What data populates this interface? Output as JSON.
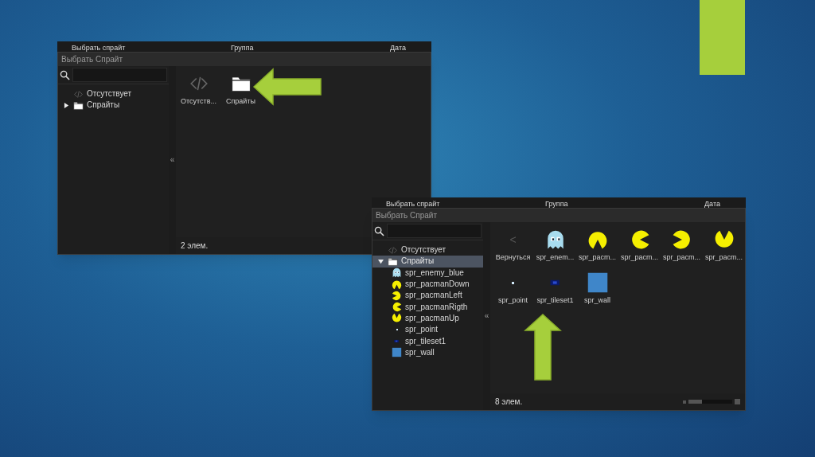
{
  "windows": [
    {
      "background_header": [
        "Выбрать спрайт",
        "Группа",
        "Дата"
      ],
      "title": "Выбрать Спрайт",
      "tree": [
        {
          "label": "Отсутствует",
          "kind": "code",
          "selected": false
        },
        {
          "label": "Спрайты",
          "kind": "folder",
          "selected": false,
          "expanded": false
        }
      ],
      "collapse_glyph": "«",
      "grid": [
        {
          "label": "Отсутств...",
          "kind": "code"
        },
        {
          "label": "Спрайты",
          "kind": "folder"
        }
      ],
      "status": "2 элем."
    },
    {
      "background_header": [
        "Выбрать спрайт",
        "Группа",
        "Дата"
      ],
      "title": "Выбрать Спрайт",
      "tree": [
        {
          "label": "Отсутствует",
          "kind": "code",
          "selected": false
        },
        {
          "label": "Спрайты",
          "kind": "folder",
          "selected": true,
          "expanded": true,
          "children": [
            {
              "label": "spr_enemy_blue",
              "kind": "ghost"
            },
            {
              "label": "spr_pacmanDown",
              "kind": "pacmandown"
            },
            {
              "label": "spr_pacmanLeft",
              "kind": "pacmanleft"
            },
            {
              "label": "spr_pacmanRigth",
              "kind": "pacmanright"
            },
            {
              "label": "spr_pacmanUp",
              "kind": "pacmanup"
            },
            {
              "label": "spr_point",
              "kind": "dot"
            },
            {
              "label": "spr_tileset1",
              "kind": "tile"
            },
            {
              "label": "spr_wall",
              "kind": "square"
            }
          ]
        }
      ],
      "collapse_glyph": "«",
      "grid": [
        {
          "label": "Вернуться",
          "kind": "back",
          "glyph": "<"
        },
        {
          "label": "spr_enem...",
          "kind": "ghost"
        },
        {
          "label": "spr_pacm...",
          "kind": "pacmandown"
        },
        {
          "label": "spr_pacm...",
          "kind": "pacmanright"
        },
        {
          "label": "spr_pacm...",
          "kind": "pacmanleft"
        },
        {
          "label": "spr_pacm...",
          "kind": "pacmanup"
        },
        {
          "label": "spr_point",
          "kind": "dot"
        },
        {
          "label": "spr_tileset1",
          "kind": "tile"
        },
        {
          "label": "spr_wall",
          "kind": "square"
        }
      ],
      "status": "8 элем.",
      "zoom": {
        "level": 0.3
      }
    }
  ]
}
